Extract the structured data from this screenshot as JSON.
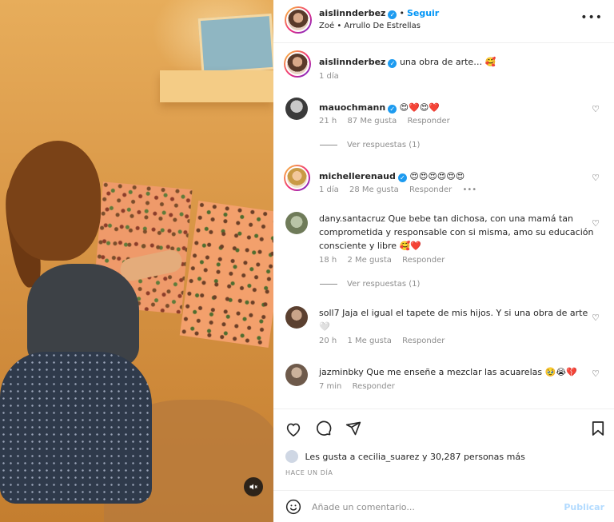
{
  "post": {
    "author": "aislinnderbez",
    "follow_label": "Seguir",
    "separator": "•",
    "subtitle_artist": "Zoé",
    "subtitle_song": "Arrullo De Estrellas",
    "more_icon": "more-horizontal-icon",
    "caption": "una obra de arte… 🥰",
    "caption_time": "1 día"
  },
  "comments": [
    {
      "user": "mauochmann",
      "verified": true,
      "text": "😍❤️😍❤️",
      "time": "21 h",
      "likes": "87 Me gusta",
      "reply": "Responder",
      "view_replies": "Ver respuestas (1)"
    },
    {
      "user": "michellerenaud",
      "verified": true,
      "text": "😍😍😍😍😍😍",
      "time": "1 día",
      "likes": "28 Me gusta",
      "reply": "Responder",
      "options": "•••"
    },
    {
      "user": "dany.santacruz",
      "verified": false,
      "text": "Que bebe tan dichosa, con una mamá tan comprometida y responsable con si misma, amo su educación consciente y libre 🥰❤️",
      "time": "18 h",
      "likes": "2 Me gusta",
      "reply": "Responder",
      "view_replies": "Ver respuestas (1)"
    },
    {
      "user": "soll7",
      "verified": false,
      "text": "Jaja el igual el tapete de mis hijos. Y si una obra de arte 🤍",
      "time": "20 h",
      "likes": "1 Me gusta",
      "reply": "Responder"
    },
    {
      "user": "jazminbky",
      "verified": false,
      "text": "Que me enseñe a mezclar las acuarelas 🥹😭💔",
      "time": "7 min",
      "reply": "Responder"
    }
  ],
  "actions": {
    "like_icon": "heart-outline-icon",
    "comment_icon": "comment-icon",
    "share_icon": "send-icon",
    "save_icon": "bookmark-icon",
    "likes_prefix": "Les gusta a",
    "likes_user": "cecilia_suarez",
    "likes_suffix": "y 30,287 personas más",
    "date": "HACE UN DÍA"
  },
  "composer": {
    "placeholder": "Añade un comentario...",
    "publish_label": "Publicar"
  },
  "media": {
    "mute_icon": "speaker-muted-icon"
  },
  "colors": {
    "accent": "#0095f6",
    "verified": "#1d9bf0",
    "muted_text": "#8e8e8e",
    "heart_red": "#ed4956"
  }
}
